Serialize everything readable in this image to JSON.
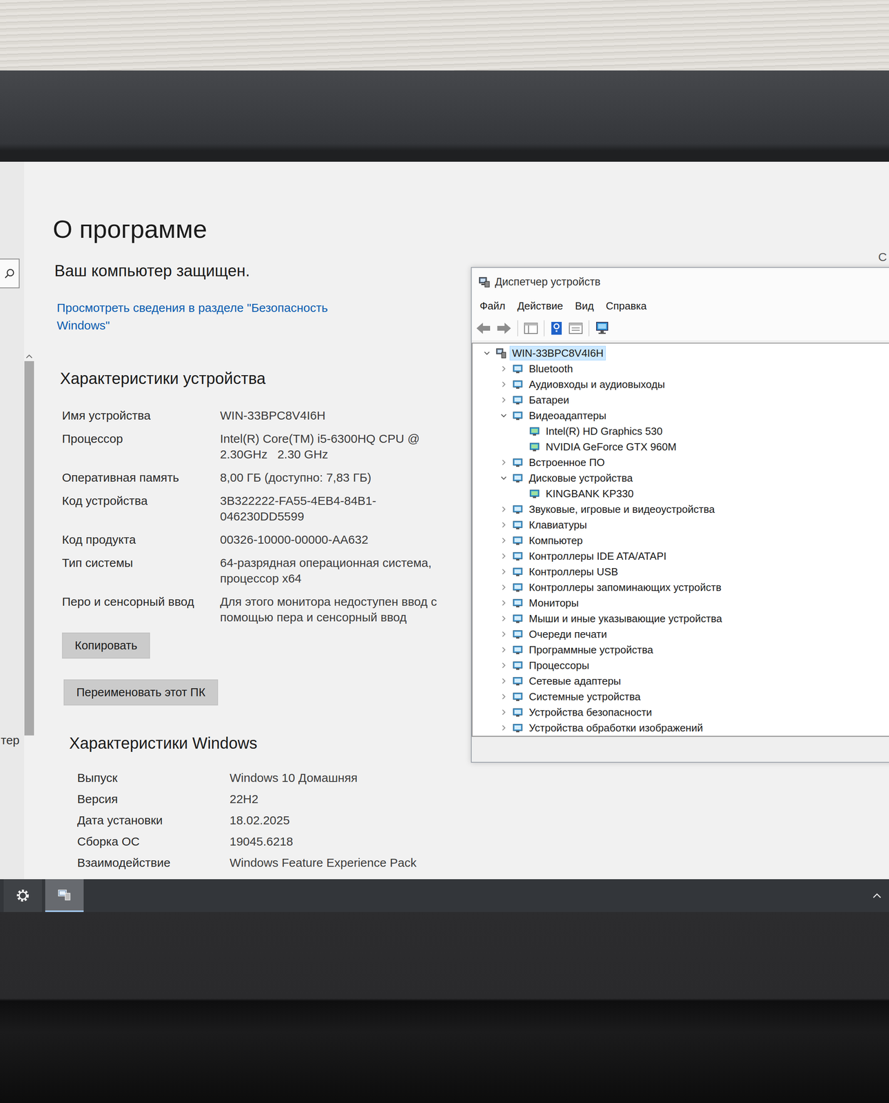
{
  "screen": {
    "edge_text": "С",
    "sidebar_text": "тер"
  },
  "settings": {
    "title": "О программе",
    "protection": "Ваш компьютер защищен.",
    "security_link": "Просмотреть сведения в разделе \"Безопасность Windows\"",
    "device_specs": {
      "heading": "Характеристики устройства",
      "rows": [
        {
          "label": "Имя устройства",
          "value": "WIN-33BPC8V4I6H"
        },
        {
          "label": "Процессор",
          "value": "Intel(R) Core(TM) i5-6300HQ CPU @ 2.30GHz   2.30 GHz"
        },
        {
          "label": "Оперативная память",
          "value": "8,00 ГБ (доступно: 7,83 ГБ)"
        },
        {
          "label": "Код устройства",
          "value": "3B322222-FA55-4EB4-84B1-046230DD5599"
        },
        {
          "label": "Код продукта",
          "value": "00326-10000-00000-AA632"
        },
        {
          "label": "Тип системы",
          "value": "64-разрядная операционная система, процессор x64"
        },
        {
          "label": "Перо и сенсорный ввод",
          "value": "Для этого монитора недоступен ввод с помощью пера и сенсорный ввод"
        }
      ]
    },
    "buttons": [
      "Копировать",
      "Переименовать этот ПК"
    ],
    "windows_specs": {
      "heading": "Характеристики Windows",
      "rows": [
        {
          "label": "Выпуск",
          "value": "Windows 10 Домашняя"
        },
        {
          "label": "Версия",
          "value": "22H2"
        },
        {
          "label": "Дата установки",
          "value": "18.02.2025"
        },
        {
          "label": "Сборка ОС",
          "value": "19045.6218"
        },
        {
          "label": "Взаимодействие",
          "value": "Windows Feature Experience Pack"
        }
      ]
    }
  },
  "device_manager": {
    "title": "Диспетчер устройств",
    "menu": [
      "Файл",
      "Действие",
      "Вид",
      "Справка"
    ],
    "tree": {
      "root": {
        "label": "WIN-33BPC8V4I6H",
        "expanded": true,
        "selected": true
      },
      "items": [
        {
          "label": "Bluetooth",
          "expanded": false,
          "selected": false,
          "children": []
        },
        {
          "label": "Аудиовходы и аудиовыходы",
          "expanded": false,
          "selected": false,
          "children": []
        },
        {
          "label": "Батареи",
          "expanded": false,
          "selected": false,
          "children": []
        },
        {
          "label": "Видеоадаптеры",
          "expanded": true,
          "selected": false,
          "children": [
            {
              "label": "Intel(R) HD Graphics 530",
              "selected": false
            },
            {
              "label": "NVIDIA GeForce GTX 960M",
              "selected": false
            }
          ]
        },
        {
          "label": "Встроенное ПО",
          "expanded": false,
          "selected": false,
          "children": []
        },
        {
          "label": "Дисковые устройства",
          "expanded": true,
          "selected": false,
          "children": [
            {
              "label": "KINGBANK KP330",
              "selected": false
            }
          ]
        },
        {
          "label": "Звуковые, игровые и видеоустройства",
          "expanded": false,
          "selected": false,
          "children": []
        },
        {
          "label": "Клавиатуры",
          "expanded": false,
          "selected": false,
          "children": []
        },
        {
          "label": "Компьютер",
          "expanded": false,
          "selected": false,
          "children": []
        },
        {
          "label": "Контроллеры IDE ATA/ATAPI",
          "expanded": false,
          "selected": false,
          "children": []
        },
        {
          "label": "Контроллеры USB",
          "expanded": false,
          "selected": false,
          "children": []
        },
        {
          "label": "Контроллеры запоминающих устройств",
          "expanded": false,
          "selected": false,
          "children": []
        },
        {
          "label": "Мониторы",
          "expanded": false,
          "selected": false,
          "children": []
        },
        {
          "label": "Мыши и иные указывающие устройства",
          "expanded": false,
          "selected": false,
          "children": []
        },
        {
          "label": "Очереди печати",
          "expanded": false,
          "selected": false,
          "children": []
        },
        {
          "label": "Программные устройства",
          "expanded": false,
          "selected": false,
          "children": []
        },
        {
          "label": "Процессоры",
          "expanded": false,
          "selected": false,
          "children": []
        },
        {
          "label": "Сетевые адаптеры",
          "expanded": false,
          "selected": false,
          "children": []
        },
        {
          "label": "Системные устройства",
          "expanded": false,
          "selected": false,
          "children": []
        },
        {
          "label": "Устройства безопасности",
          "expanded": false,
          "selected": false,
          "children": []
        },
        {
          "label": "Устройства обработки изображений",
          "expanded": false,
          "selected": false,
          "children": []
        }
      ]
    }
  },
  "taskbar": {
    "apps": [
      {
        "kind": "settings",
        "selected": false
      },
      {
        "kind": "device-manager",
        "selected": true
      }
    ]
  }
}
